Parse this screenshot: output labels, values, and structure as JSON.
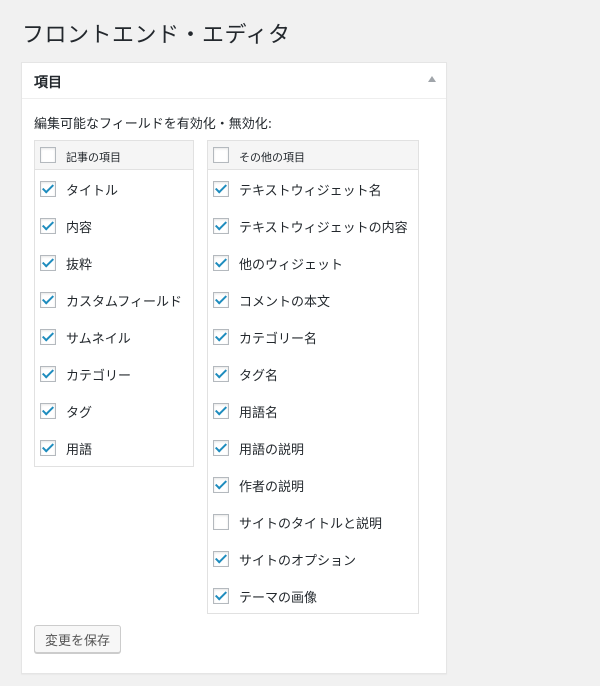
{
  "page": {
    "title": "フロントエンド・エディタ"
  },
  "panel": {
    "title": "項目",
    "description": "編集可能なフィールドを有効化・無効化:",
    "save_label": "変更を保存"
  },
  "post_fields": {
    "header": {
      "label": "記事の項目",
      "checked": false
    },
    "items": [
      {
        "label": "タイトル",
        "checked": true
      },
      {
        "label": "内容",
        "checked": true
      },
      {
        "label": "抜粋",
        "checked": true
      },
      {
        "label": "カスタムフィールド",
        "checked": true
      },
      {
        "label": "サムネイル",
        "checked": true
      },
      {
        "label": "カテゴリー",
        "checked": true
      },
      {
        "label": "タグ",
        "checked": true
      },
      {
        "label": "用語",
        "checked": true
      }
    ]
  },
  "other_fields": {
    "header": {
      "label": "その他の項目",
      "checked": false
    },
    "items": [
      {
        "label": "テキストウィジェット名",
        "checked": true
      },
      {
        "label": "テキストウィジェットの内容",
        "checked": true
      },
      {
        "label": "他のウィジェット",
        "checked": true
      },
      {
        "label": "コメントの本文",
        "checked": true
      },
      {
        "label": "カテゴリー名",
        "checked": true
      },
      {
        "label": "タグ名",
        "checked": true
      },
      {
        "label": "用語名",
        "checked": true
      },
      {
        "label": "用語の説明",
        "checked": true
      },
      {
        "label": "作者の説明",
        "checked": true
      },
      {
        "label": "サイトのタイトルと説明",
        "checked": false
      },
      {
        "label": "サイトのオプション",
        "checked": true
      },
      {
        "label": "テーマの画像",
        "checked": true
      }
    ]
  },
  "colors": {
    "accent": "#1e8cbe",
    "background": "#f1f1f1"
  },
  "icons": {
    "collapse": "triangle-up-icon",
    "check": "checkmark-icon"
  }
}
